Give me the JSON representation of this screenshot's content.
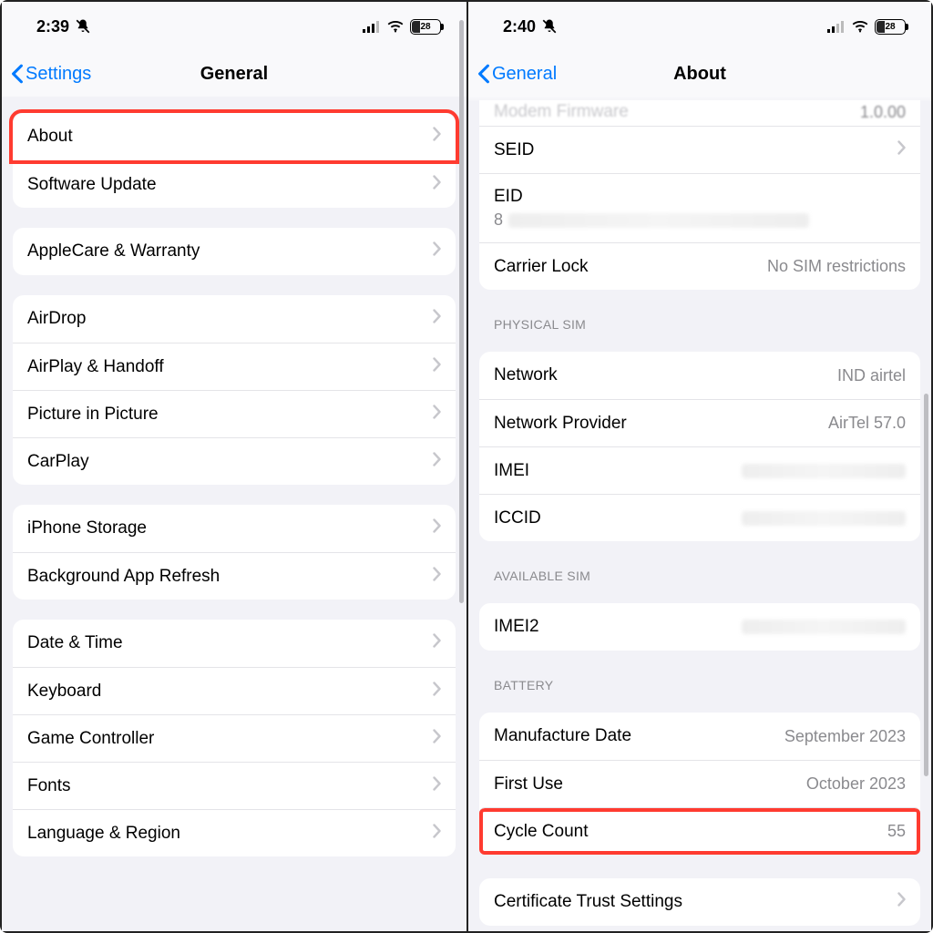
{
  "left": {
    "status": {
      "time": "2:39",
      "battery": "28"
    },
    "nav": {
      "back": "Settings",
      "title": "General"
    },
    "groups": [
      {
        "rows": [
          {
            "label": "About",
            "chev": true,
            "highlight": true
          },
          {
            "label": "Software Update",
            "chev": true
          }
        ]
      },
      {
        "rows": [
          {
            "label": "AppleCare & Warranty",
            "chev": true
          }
        ]
      },
      {
        "rows": [
          {
            "label": "AirDrop",
            "chev": true
          },
          {
            "label": "AirPlay & Handoff",
            "chev": true
          },
          {
            "label": "Picture in Picture",
            "chev": true
          },
          {
            "label": "CarPlay",
            "chev": true
          }
        ]
      },
      {
        "rows": [
          {
            "label": "iPhone Storage",
            "chev": true
          },
          {
            "label": "Background App Refresh",
            "chev": true
          }
        ]
      },
      {
        "rows": [
          {
            "label": "Date & Time",
            "chev": true
          },
          {
            "label": "Keyboard",
            "chev": true
          },
          {
            "label": "Game Controller",
            "chev": true
          },
          {
            "label": "Fonts",
            "chev": true
          },
          {
            "label": "Language & Region",
            "chev": true
          }
        ]
      }
    ]
  },
  "right": {
    "status": {
      "time": "2:40",
      "battery": "28"
    },
    "nav": {
      "back": "General",
      "title": "About"
    },
    "topPartial": {
      "rows": [
        {
          "label": "SEID",
          "chev": true
        },
        {
          "label": "EID",
          "stacked": true,
          "subPrefix": "8",
          "blur": true
        },
        {
          "label": "Carrier Lock",
          "value": "No SIM restrictions"
        }
      ]
    },
    "sections": [
      {
        "header": "PHYSICAL SIM",
        "rows": [
          {
            "label": "Network",
            "value": "IND airtel"
          },
          {
            "label": "Network Provider",
            "value": "AirTel 57.0"
          },
          {
            "label": "IMEI",
            "blur": true
          },
          {
            "label": "ICCID",
            "blur": true
          }
        ]
      },
      {
        "header": "AVAILABLE SIM",
        "rows": [
          {
            "label": "IMEI2",
            "blur": true
          }
        ]
      },
      {
        "header": "BATTERY",
        "rows": [
          {
            "label": "Manufacture Date",
            "value": "September 2023"
          },
          {
            "label": "First Use",
            "value": "October 2023"
          },
          {
            "label": "Cycle Count",
            "value": "55",
            "highlight": true
          }
        ]
      },
      {
        "rows": [
          {
            "label": "Certificate Trust Settings",
            "chev": true
          }
        ]
      }
    ]
  }
}
